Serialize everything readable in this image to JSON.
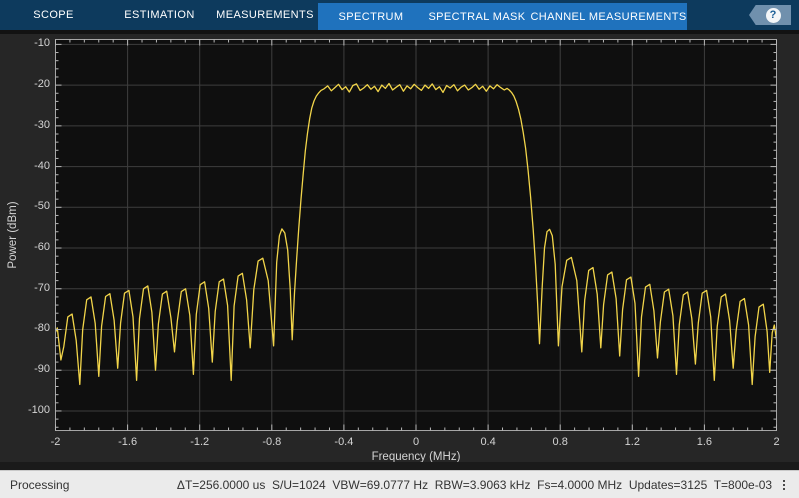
{
  "toolbar": {
    "tabs": [
      {
        "label": "SCOPE",
        "group": "main"
      },
      {
        "label": "ESTIMATION",
        "group": "main"
      },
      {
        "label": "MEASUREMENTS",
        "group": "main"
      },
      {
        "label": "SPECTRUM",
        "group": "contextual"
      },
      {
        "label": "SPECTRAL MASK",
        "group": "contextual"
      },
      {
        "label": "CHANNEL MEASUREMENTS",
        "group": "contextual"
      }
    ],
    "help_label": "?"
  },
  "status_bar": {
    "left_text": "Processing",
    "stats": [
      "ΔT=256.0000 us",
      "S/U=1024",
      "VBW=69.0777 Hz",
      "RBW=3.9063 kHz",
      "Fs=4.0000 MHz",
      "Updates=3125",
      "T=800e-03"
    ]
  },
  "chart_data": {
    "type": "line",
    "title": "",
    "xlabel": "Frequency (MHz)",
    "ylabel": "Power (dBm)",
    "xlim": [
      -2,
      2
    ],
    "ylim": [
      -104.8,
      -8.8
    ],
    "x_ticks": [
      -2,
      -1.6,
      -1.2,
      -0.8,
      -0.4,
      0,
      0.4,
      0.8,
      1.2,
      1.6,
      2
    ],
    "x_tick_labels": [
      "-2",
      "-1.6",
      "-1.2",
      "-0.8",
      "-0.4",
      "0",
      "0.4",
      "0.8",
      "1.2",
      "1.6",
      "2"
    ],
    "y_ticks": [
      -10,
      -20,
      -30,
      -40,
      -50,
      -60,
      -70,
      -80,
      -90,
      -100
    ],
    "y_tick_labels": [
      "-10",
      "-20",
      "-30",
      "-40",
      "-50",
      "-60",
      "-70",
      "-80",
      "-90",
      "-100"
    ],
    "x_minor_step": 0.08,
    "y_minor_step": 2,
    "grid": true,
    "legend": null,
    "colors": {
      "trace": "#f2d54a",
      "grid": "#3e3e3e",
      "axis": "#a6a6a6",
      "tick": "#b8b8b8",
      "label": "#d4d4d4",
      "plot_bg": "#0f0f0f",
      "figure_bg": "#262626",
      "toolbar_dark": "#0d3a5d",
      "toolbar_light": "#1f72bd"
    },
    "series": [
      {
        "name": "spectrum-trace",
        "points": [
          [
            -2.0,
            -80.7
          ],
          [
            -1.99,
            -79.6
          ],
          [
            -1.97,
            -87.5
          ],
          [
            -1.954,
            -84.2
          ],
          [
            -1.932,
            -76.9
          ],
          [
            -1.908,
            -76.2
          ],
          [
            -1.885,
            -82.7
          ],
          [
            -1.865,
            -93.5
          ],
          [
            -1.849,
            -80.0
          ],
          [
            -1.827,
            -72.7
          ],
          [
            -1.803,
            -72.0
          ],
          [
            -1.78,
            -78.5
          ],
          [
            -1.76,
            -91.5
          ],
          [
            -1.744,
            -79.2
          ],
          [
            -1.722,
            -71.9
          ],
          [
            -1.698,
            -71.2
          ],
          [
            -1.675,
            -77.7
          ],
          [
            -1.655,
            -89.5
          ],
          [
            -1.639,
            -78.4
          ],
          [
            -1.617,
            -71.1
          ],
          [
            -1.593,
            -70.4
          ],
          [
            -1.57,
            -76.9
          ],
          [
            -1.55,
            -92.5
          ],
          [
            -1.534,
            -77.3
          ],
          [
            -1.512,
            -70.0
          ],
          [
            -1.488,
            -69.3
          ],
          [
            -1.465,
            -75.8
          ],
          [
            -1.445,
            -90.0
          ],
          [
            -1.429,
            -78.6
          ],
          [
            -1.407,
            -71.3
          ],
          [
            -1.383,
            -70.6
          ],
          [
            -1.36,
            -77.1
          ],
          [
            -1.34,
            -85.5
          ],
          [
            -1.324,
            -78.0
          ],
          [
            -1.302,
            -70.7
          ],
          [
            -1.278,
            -70.0
          ],
          [
            -1.255,
            -76.5
          ],
          [
            -1.235,
            -91.0
          ],
          [
            -1.219,
            -76.3
          ],
          [
            -1.197,
            -69.0
          ],
          [
            -1.173,
            -68.3
          ],
          [
            -1.15,
            -74.8
          ],
          [
            -1.13,
            -88.0
          ],
          [
            -1.114,
            -75.6
          ],
          [
            -1.092,
            -68.3
          ],
          [
            -1.068,
            -67.6
          ],
          [
            -1.045,
            -74.1
          ],
          [
            -1.025,
            -92.5
          ],
          [
            -1.009,
            -74.2
          ],
          [
            -0.987,
            -66.9
          ],
          [
            -0.963,
            -66.2
          ],
          [
            -0.94,
            -72.7
          ],
          [
            -0.92,
            -84.5
          ],
          [
            -0.9,
            -70.2
          ],
          [
            -0.876,
            -63.2
          ],
          [
            -0.85,
            -62.5
          ],
          [
            -0.82,
            -68.0
          ],
          [
            -0.79,
            -84.0
          ],
          [
            -0.773,
            -63.5
          ],
          [
            -0.758,
            -57.0
          ],
          [
            -0.744,
            -55.3
          ],
          [
            -0.728,
            -56.3
          ],
          [
            -0.712,
            -60.5
          ],
          [
            -0.698,
            -70.0
          ],
          [
            -0.687,
            -82.5
          ],
          [
            -0.674,
            -71.0
          ],
          [
            -0.662,
            -62.5
          ],
          [
            -0.65,
            -55.0
          ],
          [
            -0.638,
            -48.0
          ],
          [
            -0.626,
            -41.8
          ],
          [
            -0.614,
            -36.2
          ],
          [
            -0.602,
            -31.8
          ],
          [
            -0.59,
            -28.2
          ],
          [
            -0.578,
            -25.6
          ],
          [
            -0.566,
            -23.9
          ],
          [
            -0.553,
            -22.7
          ],
          [
            -0.54,
            -21.9
          ],
          [
            -0.527,
            -21.3
          ],
          [
            -0.51,
            -20.9
          ],
          [
            -0.49,
            -20.2
          ],
          [
            -0.47,
            -21.4
          ],
          [
            -0.45,
            -20.6
          ],
          [
            -0.43,
            -19.8
          ],
          [
            -0.41,
            -21.1
          ],
          [
            -0.39,
            -20.4
          ],
          [
            -0.37,
            -21.7
          ],
          [
            -0.35,
            -20.1
          ],
          [
            -0.33,
            -19.7
          ],
          [
            -0.31,
            -21.3
          ],
          [
            -0.29,
            -20.7
          ],
          [
            -0.27,
            -19.9
          ],
          [
            -0.25,
            -21.0
          ],
          [
            -0.23,
            -20.3
          ],
          [
            -0.21,
            -21.6
          ],
          [
            -0.19,
            -20.0
          ],
          [
            -0.17,
            -20.8
          ],
          [
            -0.15,
            -19.6
          ],
          [
            -0.13,
            -21.2
          ],
          [
            -0.11,
            -20.5
          ],
          [
            -0.09,
            -19.9
          ],
          [
            -0.07,
            -21.5
          ],
          [
            -0.05,
            -20.2
          ],
          [
            -0.03,
            -20.9
          ],
          [
            -0.01,
            -19.8
          ],
          [
            0.01,
            -20.6
          ],
          [
            0.03,
            -21.3
          ],
          [
            0.05,
            -20.0
          ],
          [
            0.07,
            -20.8
          ],
          [
            0.09,
            -19.7
          ],
          [
            0.11,
            -21.1
          ],
          [
            0.13,
            -20.4
          ],
          [
            0.15,
            -21.8
          ],
          [
            0.17,
            -20.1
          ],
          [
            0.19,
            -20.7
          ],
          [
            0.21,
            -19.9
          ],
          [
            0.23,
            -21.4
          ],
          [
            0.25,
            -20.5
          ],
          [
            0.27,
            -20.0
          ],
          [
            0.29,
            -21.2
          ],
          [
            0.31,
            -20.6
          ],
          [
            0.33,
            -19.8
          ],
          [
            0.35,
            -21.0
          ],
          [
            0.37,
            -20.3
          ],
          [
            0.39,
            -21.5
          ],
          [
            0.41,
            -20.2
          ],
          [
            0.43,
            -20.9
          ],
          [
            0.45,
            -19.9
          ],
          [
            0.47,
            -20.6
          ],
          [
            0.49,
            -21.2
          ],
          [
            0.505,
            -20.8
          ],
          [
            0.517,
            -21.2
          ],
          [
            0.53,
            -21.8
          ],
          [
            0.543,
            -22.7
          ],
          [
            0.556,
            -24.1
          ],
          [
            0.569,
            -26.0
          ],
          [
            0.582,
            -28.4
          ],
          [
            0.595,
            -31.6
          ],
          [
            0.608,
            -35.5
          ],
          [
            0.622,
            -41.0
          ],
          [
            0.636,
            -47.5
          ],
          [
            0.65,
            -55.5
          ],
          [
            0.663,
            -64.0
          ],
          [
            0.674,
            -73.0
          ],
          [
            0.685,
            -83.5
          ],
          [
            0.7,
            -69.5
          ],
          [
            0.713,
            -60.0
          ],
          [
            0.727,
            -56.0
          ],
          [
            0.741,
            -55.4
          ],
          [
            0.756,
            -57.0
          ],
          [
            0.772,
            -64.0
          ],
          [
            0.79,
            -84.0
          ],
          [
            0.81,
            -69.5
          ],
          [
            0.836,
            -63.0
          ],
          [
            0.862,
            -62.3
          ],
          [
            0.892,
            -68.0
          ],
          [
            0.92,
            -85.5
          ],
          [
            0.936,
            -72.8
          ],
          [
            0.958,
            -65.5
          ],
          [
            0.982,
            -64.8
          ],
          [
            1.005,
            -71.3
          ],
          [
            1.025,
            -84.5
          ],
          [
            1.041,
            -73.9
          ],
          [
            1.063,
            -66.6
          ],
          [
            1.087,
            -65.9
          ],
          [
            1.11,
            -72.4
          ],
          [
            1.13,
            -86.5
          ],
          [
            1.146,
            -75.1
          ],
          [
            1.168,
            -67.8
          ],
          [
            1.192,
            -67.1
          ],
          [
            1.215,
            -73.6
          ],
          [
            1.235,
            -91.5
          ],
          [
            1.251,
            -76.9
          ],
          [
            1.273,
            -69.6
          ],
          [
            1.297,
            -68.9
          ],
          [
            1.32,
            -75.4
          ],
          [
            1.34,
            -87.0
          ],
          [
            1.356,
            -78.1
          ],
          [
            1.378,
            -70.8
          ],
          [
            1.402,
            -70.1
          ],
          [
            1.425,
            -76.6
          ],
          [
            1.445,
            -91.0
          ],
          [
            1.461,
            -78.8
          ],
          [
            1.483,
            -71.5
          ],
          [
            1.507,
            -70.8
          ],
          [
            1.53,
            -77.3
          ],
          [
            1.55,
            -88.5
          ],
          [
            1.566,
            -78.4
          ],
          [
            1.588,
            -71.1
          ],
          [
            1.612,
            -70.4
          ],
          [
            1.635,
            -76.9
          ],
          [
            1.655,
            -92.5
          ],
          [
            1.671,
            -79.3
          ],
          [
            1.693,
            -72.0
          ],
          [
            1.717,
            -71.3
          ],
          [
            1.74,
            -77.8
          ],
          [
            1.76,
            -89.5
          ],
          [
            1.776,
            -80.4
          ],
          [
            1.798,
            -73.1
          ],
          [
            1.822,
            -72.4
          ],
          [
            1.845,
            -78.9
          ],
          [
            1.865,
            -93.5
          ],
          [
            1.881,
            -81.8
          ],
          [
            1.903,
            -74.5
          ],
          [
            1.927,
            -73.8
          ],
          [
            1.948,
            -80.5
          ],
          [
            1.962,
            -90.5
          ],
          [
            1.976,
            -80.8
          ],
          [
            1.988,
            -78.9
          ],
          [
            2.0,
            -82.5
          ]
        ]
      }
    ]
  }
}
